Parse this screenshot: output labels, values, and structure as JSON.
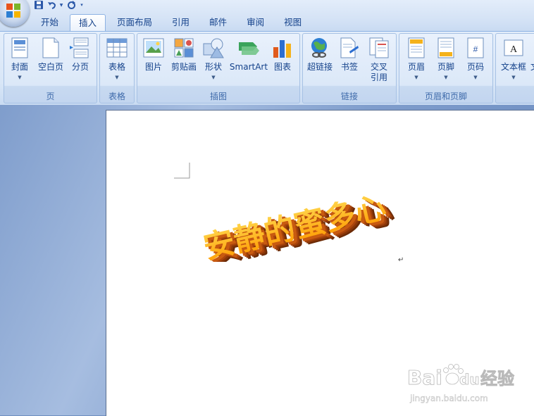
{
  "tabs": [
    "开始",
    "插入",
    "页面布局",
    "引用",
    "邮件",
    "审阅",
    "视图"
  ],
  "active_tab": "插入",
  "groups": {
    "page": {
      "label": "页",
      "buttons": [
        "封面",
        "空白页",
        "分页"
      ]
    },
    "table": {
      "label": "表格",
      "buttons": [
        "表格"
      ]
    },
    "illustrations": {
      "label": "插图",
      "buttons": [
        "图片",
        "剪贴画",
        "形状",
        "SmartArt",
        "图表"
      ]
    },
    "links": {
      "label": "链接",
      "buttons": [
        "超链接",
        "书签",
        "交叉",
        "引用"
      ]
    },
    "header_footer": {
      "label": "页眉和页脚",
      "buttons": [
        "页眉",
        "页脚",
        "页码"
      ]
    },
    "text": {
      "buttons": [
        "文本框",
        "文"
      ]
    }
  },
  "document": {
    "wordart_text": "安静的蜜多心",
    "paragraph_mark": "↵"
  },
  "watermark": {
    "brand": "Bai",
    "brand2": "du",
    "cn": "经验",
    "url": "jingyan.baidu.com"
  },
  "colors": {
    "ribbon_text": "#15428b",
    "wordart_face": "#ffb000",
    "wordart_side": "#c85a10"
  }
}
